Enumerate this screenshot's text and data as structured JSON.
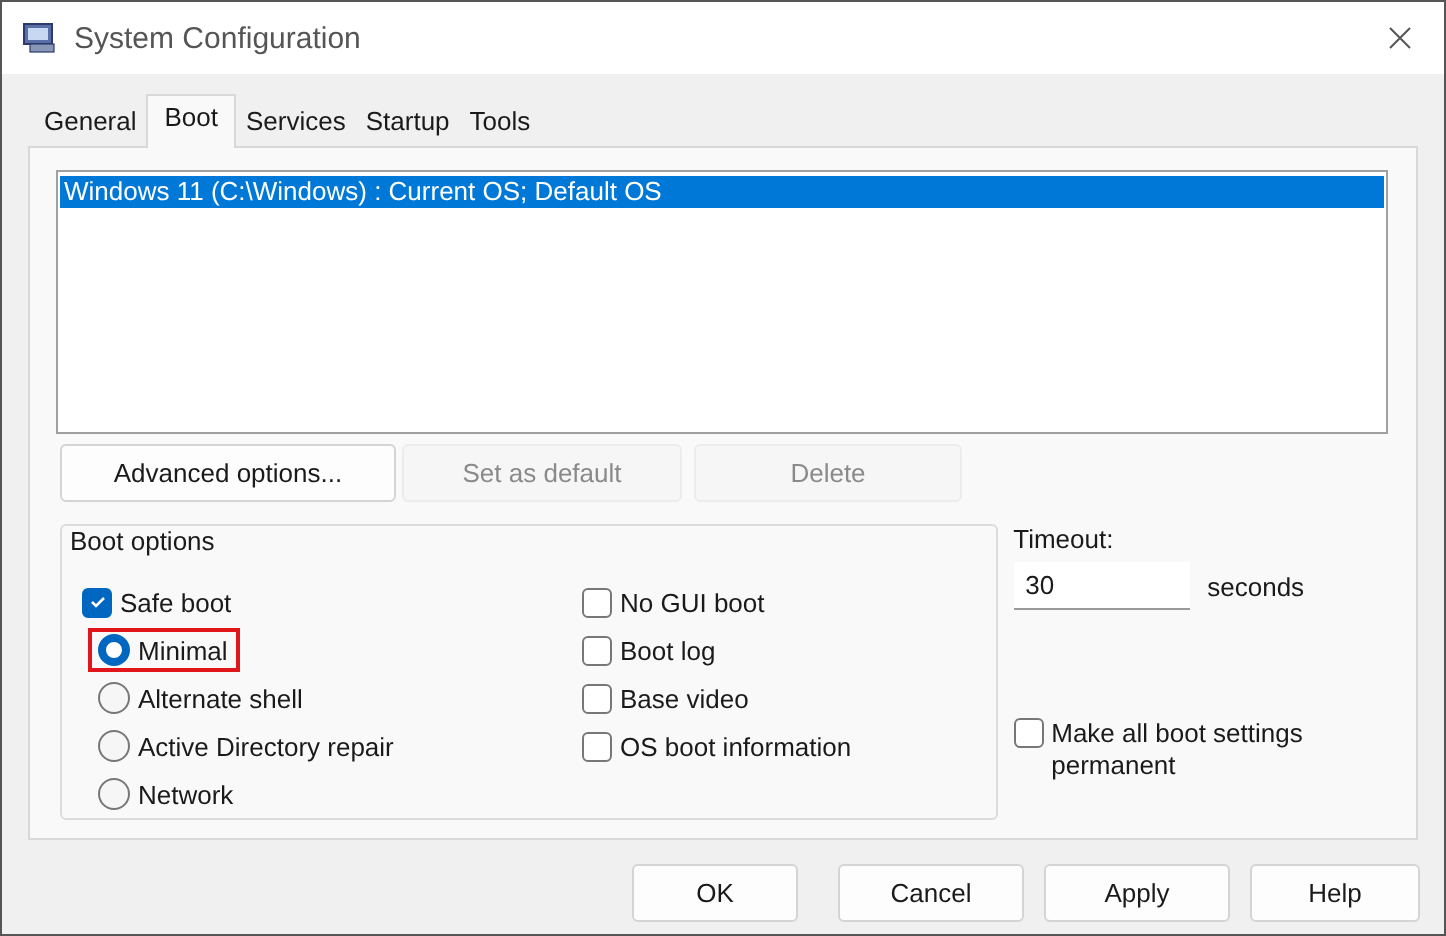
{
  "window": {
    "title": "System Configuration"
  },
  "tabs": [
    {
      "label": "General",
      "selected": false
    },
    {
      "label": "Boot",
      "selected": true
    },
    {
      "label": "Services",
      "selected": false
    },
    {
      "label": "Startup",
      "selected": false
    },
    {
      "label": "Tools",
      "selected": false
    }
  ],
  "os_list": [
    {
      "label": "Windows 11 (C:\\Windows) : Current OS; Default OS",
      "selected": true
    }
  ],
  "list_buttons": [
    {
      "label": "Advanced options...",
      "disabled": false
    },
    {
      "label": "Set as default",
      "disabled": true
    },
    {
      "label": "Delete",
      "disabled": true
    }
  ],
  "boot_options": {
    "title": "Boot options",
    "safe_boot": {
      "label": "Safe boot",
      "checked": true
    },
    "safe_boot_modes": [
      {
        "label": "Minimal",
        "selected": true,
        "highlighted": true
      },
      {
        "label": "Alternate shell",
        "selected": false,
        "highlighted": false
      },
      {
        "label": "Active Directory repair",
        "selected": false,
        "highlighted": false
      },
      {
        "label": "Network",
        "selected": false,
        "highlighted": false
      }
    ],
    "flags": [
      {
        "label": "No GUI boot",
        "checked": false
      },
      {
        "label": "Boot log",
        "checked": false
      },
      {
        "label": "Base video",
        "checked": false
      },
      {
        "label": "OS boot information",
        "checked": false
      }
    ]
  },
  "timeout": {
    "label": "Timeout:",
    "value": "30",
    "unit": "seconds"
  },
  "permanent": {
    "label": "Make all boot settings permanent",
    "checked": false
  },
  "buttons": [
    {
      "label": "OK"
    },
    {
      "label": "Cancel"
    },
    {
      "label": "Apply"
    },
    {
      "label": "Help"
    }
  ]
}
